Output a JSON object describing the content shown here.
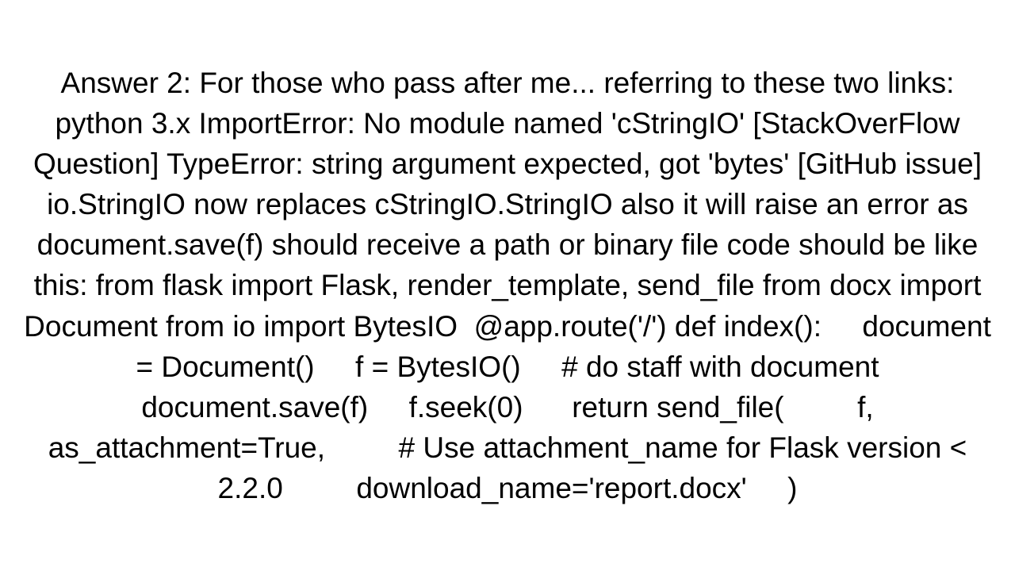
{
  "answer": {
    "text": "Answer 2: For those who pass after me... referring to these two links:  python 3.x ImportError: No module named 'cStringIO' [StackOverFlow Question] TypeError: string argument expected, got 'bytes' [GitHub issue]   io.StringIO now replaces cStringIO.StringIO also it will raise an error as document.save(f) should receive a path or binary file code should be like this: from flask import Flask, render_template, send_file from docx import Document from io import BytesIO  @app.route('/') def index():     document = Document()     f = BytesIO()     # do staff with document     document.save(f)     f.seek(0)      return send_file(         f,         as_attachment=True,         # Use attachment_name for Flask version < 2.2.0         download_name='report.docx'     )"
  }
}
